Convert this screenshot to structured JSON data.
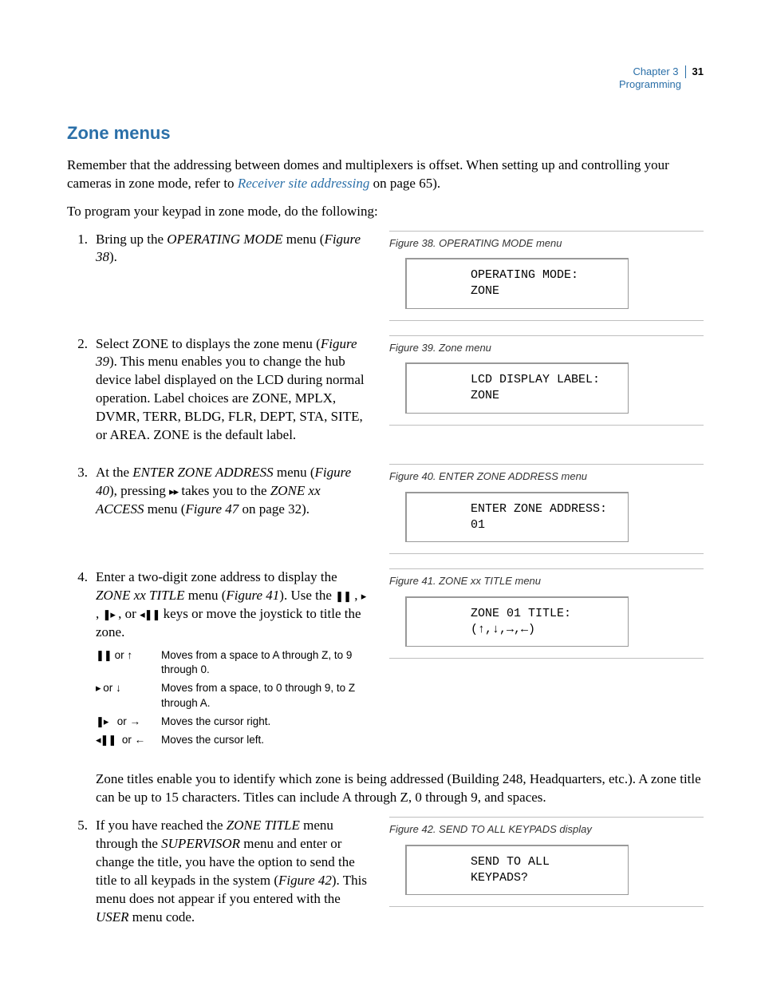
{
  "header": {
    "chapter": "Chapter 3",
    "section": "Programming",
    "page_number": "31"
  },
  "title": "Zone menus",
  "intro_before_link": "Remember that the addressing between domes and multiplexers is offset. When setting up and controlling your cameras in zone mode, refer to ",
  "intro_link_text": "Receiver site addressing",
  "intro_after_link": " on page 65).",
  "lead_in": "To program your keypad in zone mode, do the following:",
  "steps": {
    "s1": {
      "num": "1.",
      "pre": "Bring up the ",
      "em1": "OPERATING MODE",
      "mid": " menu (",
      "em2": "Figure 38",
      "post": ")."
    },
    "s2": {
      "num": "2.",
      "text": "Select ZONE to displays the zone menu (Figure 39).  This menu enables you to change the hub device label displayed on the LCD during normal operation. Label choices are ZONE, MPLX, DVMR, TERR, BLDG, FLR, DEPT, STA, SITE, or AREA. ZONE is the default label."
    },
    "s3": {
      "num": "3.",
      "a": "At the ",
      "em1": "ENTER ZONE ADDRESS",
      "b": " menu (",
      "em2": "Figure 40",
      "c": "), pressing ",
      "icon": "▸▸",
      "d": " takes you to the ",
      "em3": "ZONE xx ACCESS",
      "e": " menu (",
      "em4": "Figure 47",
      "f": " on page 32)."
    },
    "s4": {
      "num": "4.",
      "a": "Enter a two-digit zone address to display the ",
      "em1": "ZONE xx TITLE",
      "b": " menu (",
      "em2": "Figure 41",
      "c": "). Use the ",
      "d": "  keys or move the joystick to title the zone."
    },
    "s5": {
      "num": "5.",
      "a": "If you have reached the ",
      "em1": "ZONE TITLE",
      "b": " menu through the ",
      "em2": "SUPERVISOR",
      "c": " menu and enter or change the title, you have the option to send the title to all keypads in the system (",
      "em3": "Figure 42",
      "d": "). This menu does not appear if you entered with the ",
      "em4": "USER",
      "e": " menu code."
    }
  },
  "key_glyphs": {
    "pause": "❚❚",
    "play": "▸",
    "ffwd": "❚▸",
    "rew": "◂❚❚",
    "or": "or"
  },
  "key_table": {
    "r1": {
      "arrow": "↑",
      "desc": "Moves from a space to A through Z, to 9 through 0."
    },
    "r2": {
      "arrow": "↓",
      "desc": "Moves from a space, to 0 through 9, to Z through A."
    },
    "r3": {
      "arrow": "→",
      "desc": "Moves the cursor right."
    },
    "r4": {
      "arrow": "←",
      "desc": "Moves the cursor left."
    }
  },
  "note_para": "Zone titles enable you to identify which zone is being addressed (Building 248, Headquarters, etc.). A zone title can be up to 15 characters. Titles can include A through Z, 0 through 9, and spaces.",
  "figures": {
    "f38": {
      "caption": "Figure 38. OPERATING MODE menu",
      "line1": "OPERATING MODE:",
      "line2": "ZONE"
    },
    "f39": {
      "caption": "Figure 39. Zone menu",
      "line1": "LCD DISPLAY LABEL:",
      "line2": "ZONE"
    },
    "f40": {
      "caption": "Figure 40. ENTER ZONE ADDRESS menu",
      "line1": "ENTER ZONE ADDRESS:",
      "line2": "01"
    },
    "f41": {
      "caption": "Figure 41. ZONE xx TITLE menu",
      "line1": "ZONE 01 TITLE:",
      "line2": "(↑,↓,→,←)"
    },
    "f42": {
      "caption": "Figure 42. SEND TO ALL KEYPADS display",
      "line1": "SEND TO ALL",
      "line2": "KEYPADS?"
    }
  }
}
